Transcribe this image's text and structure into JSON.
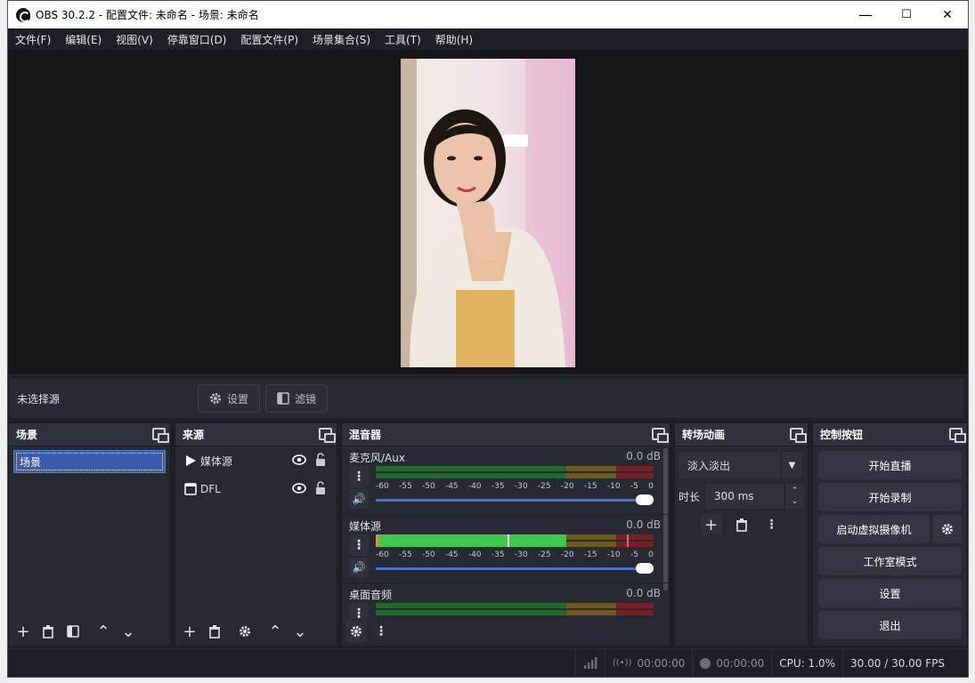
{
  "window": {
    "title": "OBS 30.2.2 - 配置文件: 未命名 - 场景: 未命名",
    "minimize": "—",
    "maximize": "☐",
    "close": "✕"
  },
  "menu": {
    "file": "文件(F)",
    "edit": "编辑(E)",
    "view": "视图(V)",
    "docks": "停靠窗口(D)",
    "profile": "配置文件(P)",
    "scene_collection": "场景集合(S)",
    "tools": "工具(T)",
    "help": "帮助(H)"
  },
  "source_bar": {
    "no_selection": "未选择源",
    "settings": "设置",
    "filters": "滤镜"
  },
  "scenes": {
    "title": "场景",
    "items": [
      "场景"
    ]
  },
  "sources": {
    "title": "来源",
    "items": [
      {
        "name": "媒体源",
        "icon": "play-icon"
      },
      {
        "name": "DFL",
        "icon": "window-icon"
      }
    ]
  },
  "mixer": {
    "title": "混音器",
    "scale": [
      "-60",
      "-55",
      "-50",
      "-45",
      "-40",
      "-35",
      "-30",
      "-25",
      "-20",
      "-15",
      "-10",
      "-5",
      "0"
    ],
    "channels": [
      {
        "name": "麦克风/Aux",
        "db": "0.0 dB",
        "level": 0
      },
      {
        "name": "媒体源",
        "db": "0.0 dB",
        "level": 0.85
      },
      {
        "name": "桌面音频",
        "db": "0.0 dB",
        "level": 0
      }
    ]
  },
  "transitions": {
    "title": "转场动画",
    "selected": "淡入淡出",
    "duration_label": "时长",
    "duration_value": "300 ms"
  },
  "controls": {
    "title": "控制按钮",
    "start_stream": "开始直播",
    "start_record": "开始录制",
    "virtual_camera": "启动虚拟摄像机",
    "studio_mode": "工作室模式",
    "settings": "设置",
    "exit": "退出"
  },
  "status": {
    "live_time": "00:00:00",
    "rec_time": "00:00:00",
    "cpu": "CPU: 1.0%",
    "fps": "30.00 / 30.00 FPS"
  },
  "colors": {
    "accent": "#4d6fd8",
    "meter_green": "#3ec94a",
    "meter_yellow": "#c6a13a",
    "meter_red": "#c53a3a"
  }
}
